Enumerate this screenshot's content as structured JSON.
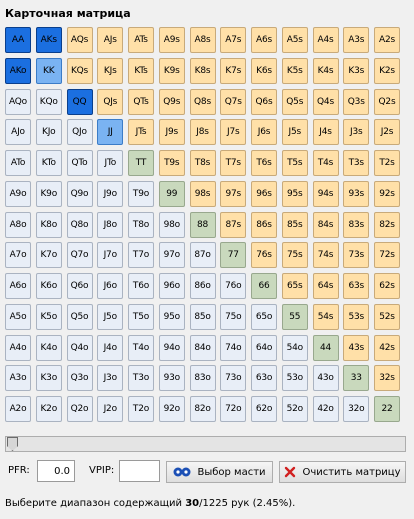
{
  "title": "Карточная матрица",
  "hands": [
    [
      "AA",
      "AKs",
      "AQs",
      "AJs",
      "ATs",
      "A9s",
      "A8s",
      "A7s",
      "A6s",
      "A5s",
      "A4s",
      "A3s",
      "A2s"
    ],
    [
      "AKo",
      "KK",
      "KQs",
      "KJs",
      "KTs",
      "K9s",
      "K8s",
      "K7s",
      "K6s",
      "K5s",
      "K4s",
      "K3s",
      "K2s"
    ],
    [
      "AQo",
      "KQo",
      "QQ",
      "QJs",
      "QTs",
      "Q9s",
      "Q8s",
      "Q7s",
      "Q6s",
      "Q5s",
      "Q4s",
      "Q3s",
      "Q2s"
    ],
    [
      "AJo",
      "KJo",
      "QJo",
      "JJ",
      "JTs",
      "J9s",
      "J8s",
      "J7s",
      "J6s",
      "J5s",
      "J4s",
      "J3s",
      "J2s"
    ],
    [
      "ATo",
      "KTo",
      "QTo",
      "JTo",
      "TT",
      "T9s",
      "T8s",
      "T7s",
      "T6s",
      "T5s",
      "T4s",
      "T3s",
      "T2s"
    ],
    [
      "A9o",
      "K9o",
      "Q9o",
      "J9o",
      "T9o",
      "99",
      "98s",
      "97s",
      "96s",
      "95s",
      "94s",
      "93s",
      "92s"
    ],
    [
      "A8o",
      "K8o",
      "Q8o",
      "J8o",
      "T8o",
      "98o",
      "88",
      "87s",
      "86s",
      "85s",
      "84s",
      "83s",
      "82s"
    ],
    [
      "A7o",
      "K7o",
      "Q7o",
      "J7o",
      "T7o",
      "97o",
      "87o",
      "77",
      "76s",
      "75s",
      "74s",
      "73s",
      "72s"
    ],
    [
      "A6o",
      "K6o",
      "Q6o",
      "J6o",
      "T6o",
      "96o",
      "86o",
      "76o",
      "66",
      "65s",
      "64s",
      "63s",
      "62s"
    ],
    [
      "A5o",
      "K5o",
      "Q5o",
      "J5o",
      "T5o",
      "95o",
      "85o",
      "75o",
      "65o",
      "55",
      "54s",
      "53s",
      "52s"
    ],
    [
      "A4o",
      "K4o",
      "Q4o",
      "J4o",
      "T4o",
      "94o",
      "84o",
      "74o",
      "64o",
      "54o",
      "44",
      "43s",
      "42s"
    ],
    [
      "A3o",
      "K3o",
      "Q3o",
      "J3o",
      "T3o",
      "93o",
      "83o",
      "73o",
      "63o",
      "53o",
      "43o",
      "33",
      "32s"
    ],
    [
      "A2o",
      "K2o",
      "Q2o",
      "J2o",
      "T2o",
      "92o",
      "82o",
      "72o",
      "62o",
      "52o",
      "42o",
      "32o",
      "22"
    ]
  ],
  "selected_dark": [
    "AA",
    "AKs",
    "AKo",
    "QQ"
  ],
  "selected_light": [
    "KK",
    "JJ"
  ],
  "colors": {
    "offsuit": "#e8eef7",
    "suited": "#ffe0a8",
    "pair": "#c9d9bd",
    "selected_dark": "#1b6fe0",
    "selected_light": "#7ab3f2"
  },
  "slider_value": 0,
  "pfr": {
    "label": "PFR:",
    "value": "0.0"
  },
  "vpip": {
    "label": "VPIP:",
    "value": ""
  },
  "buttons": {
    "suit_select": "Выбор масти",
    "clear_matrix": "Очистить матрицу"
  },
  "status": {
    "prefix": "Выберите диапазон содержащий ",
    "count": "30",
    "suffix": "/1225 рук (2.45%)."
  }
}
